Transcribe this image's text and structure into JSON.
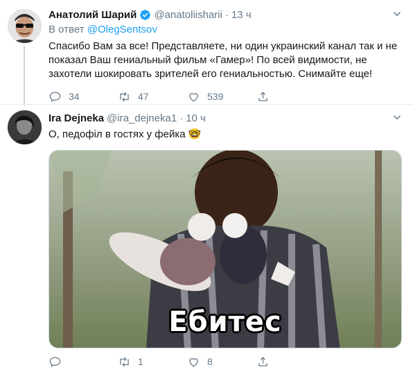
{
  "tweet1": {
    "name": "Анатолий Шарий",
    "handle": "@anatoliisharii",
    "dot": "·",
    "time": "13 ч",
    "reply_prefix": "В ответ",
    "reply_mention": "@OlegSentsov",
    "text_lines": [
      "Спасибо Вам за все! Представляете, ни один украинский канал так и не",
      "показал Ваш гениальный фильм «Гамер»! По всей видимости, не",
      "захотели шокировать зрителей его гениальностью. Снимайте еще!"
    ],
    "reply_count": "34",
    "retweet_count": "47",
    "like_count": "539"
  },
  "tweet2": {
    "name": "Ira Dejneka",
    "handle": "@ira_dejneka1",
    "dot": "·",
    "time": "10 ч",
    "text": "О, педофіл в гостях у фейка 🤓",
    "image_caption": "Ебитес",
    "reply_count": "",
    "retweet_count": "1",
    "like_count": "8"
  },
  "icons": {
    "verified": "verified-badge-icon",
    "caret": "chevron-down-icon",
    "reply": "reply-icon",
    "retweet": "retweet-icon",
    "like": "heart-icon",
    "share": "share-icon"
  },
  "colors": {
    "accent": "#1da1f2",
    "secondary_text": "#657786",
    "primary_text": "#14171a",
    "divider": "#e6ecf0"
  }
}
